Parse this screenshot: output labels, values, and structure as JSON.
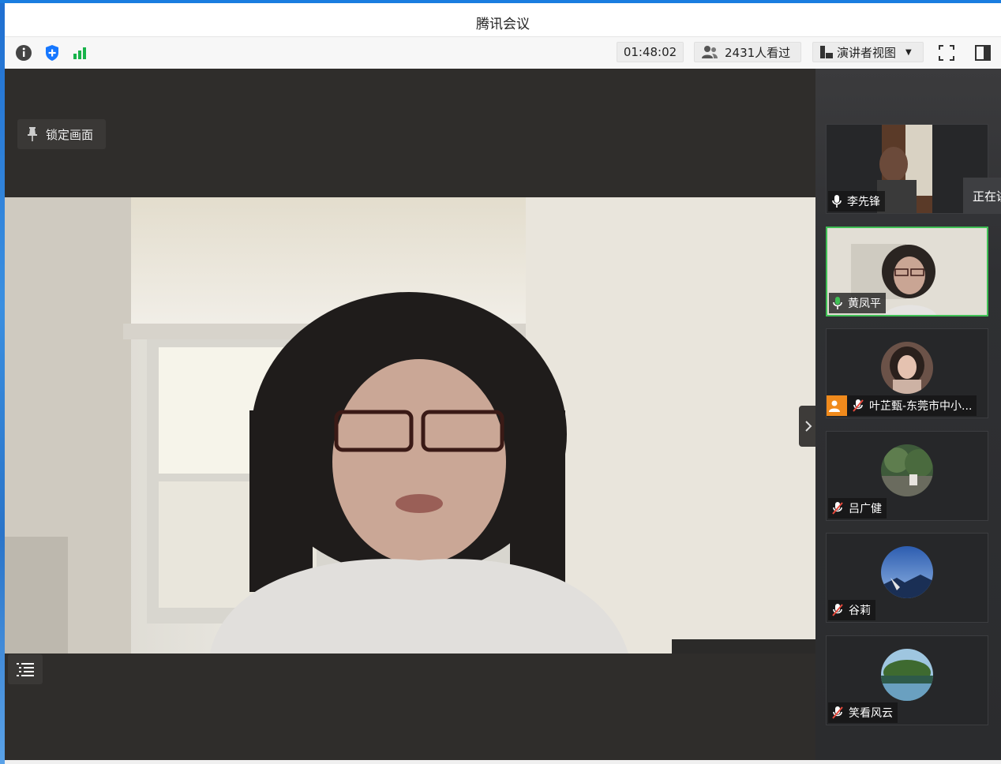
{
  "window": {
    "title": "腾讯会议"
  },
  "toolbar": {
    "timer": "01:48:02",
    "viewers": "2431人看过",
    "view_mode": "演讲者视图",
    "icons": [
      "info-icon",
      "shield-icon",
      "signal-icon",
      "people-icon",
      "layout-icon",
      "dropdown-arrow-icon",
      "fullscreen-icon",
      "side-panel-icon"
    ]
  },
  "stage": {
    "lock_label": "锁定画面",
    "icons": [
      "pin-icon",
      "list-icon",
      "chevron-right-icon"
    ]
  },
  "participants": [
    {
      "name": "李先锋",
      "mic": "on"
    },
    {
      "name": "黄凤平",
      "mic": "speaking"
    },
    {
      "name": "叶芷甄-东莞市中小...",
      "mic": "muted"
    },
    {
      "name": "吕广健",
      "mic": "muted"
    },
    {
      "name": "谷莉",
      "mic": "muted"
    },
    {
      "name": "笑看风云",
      "mic": "muted"
    }
  ],
  "tooltip": {
    "text": "正在讲话"
  },
  "colors": {
    "accent": "#1a7de0",
    "speaking_border": "#3fbf55",
    "shield_blue": "#1677ff",
    "signal_green": "#17b34a",
    "muted_red": "#e84a3d"
  }
}
